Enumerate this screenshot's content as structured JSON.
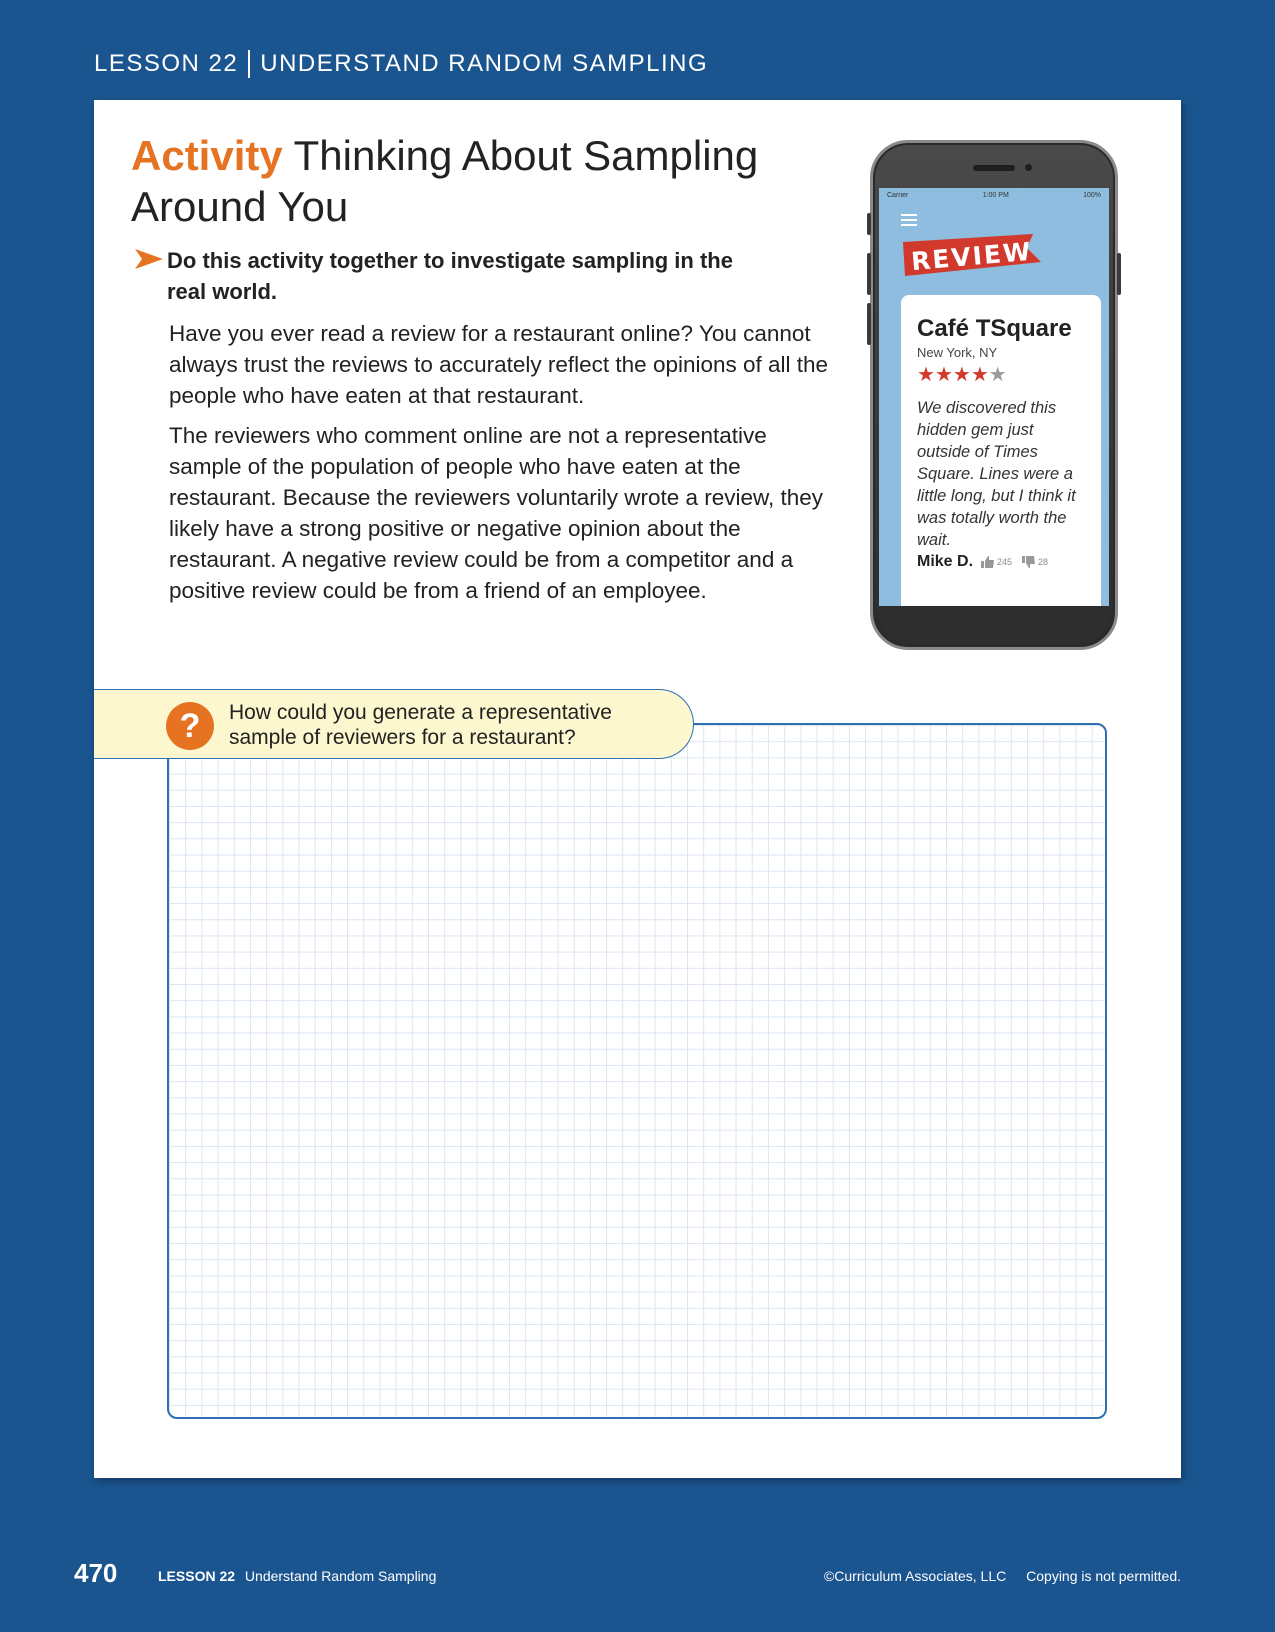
{
  "header": {
    "lesson": "LESSON 22",
    "topic": "UNDERSTAND RANDOM SAMPLING"
  },
  "activity": {
    "label": "Activity",
    "title": "Thinking About Sampling Around You",
    "instruction": "Do this activity together to investigate sampling in the real world.",
    "paragraph1": "Have you ever read a review for a restaurant online? You cannot always trust the reviews to accurately reflect the opinions of all the people who have eaten at that restaurant.",
    "paragraph2": "The reviewers who comment online are not a representative sample of the population of people who have eaten at the restaurant. Because the reviewers voluntarily wrote a review, they likely have a strong positive or negative opinion about the restaurant. A negative review could be from a competitor and a positive review could be from a friend of an employee."
  },
  "phone": {
    "status": {
      "carrier": "Carrier",
      "time": "1:00 PM",
      "battery": "100%"
    },
    "banner": "REVIEW",
    "review": {
      "restaurant": "Café TSquare",
      "location": "New York, NY",
      "rating": 4,
      "max_rating": 5,
      "text": "We discovered this hidden gem just outside of Times Square. Lines were a little long, but I think it was totally worth the wait.",
      "reviewer": "Mike D.",
      "likes": "245",
      "dislikes": "28"
    },
    "colors": {
      "screen": "#8fbde0",
      "banner": "#d1392c",
      "star_on": "#d1392c",
      "star_off": "#9a9a9a"
    }
  },
  "question": {
    "icon": "question-mark-icon",
    "text": "How could you generate a representative sample of reviewers for a restaurant?"
  },
  "footer": {
    "page_number": "470",
    "lesson_label": "LESSON 22",
    "lesson_title": "Understand Random Sampling",
    "copyright": "©Curriculum Associates, LLC",
    "notice": "Copying is not permitted."
  },
  "colors": {
    "background": "#1b5590",
    "accent": "#e57322",
    "grid_border": "#2f6fb3",
    "question_bg": "#fdf7cf"
  }
}
